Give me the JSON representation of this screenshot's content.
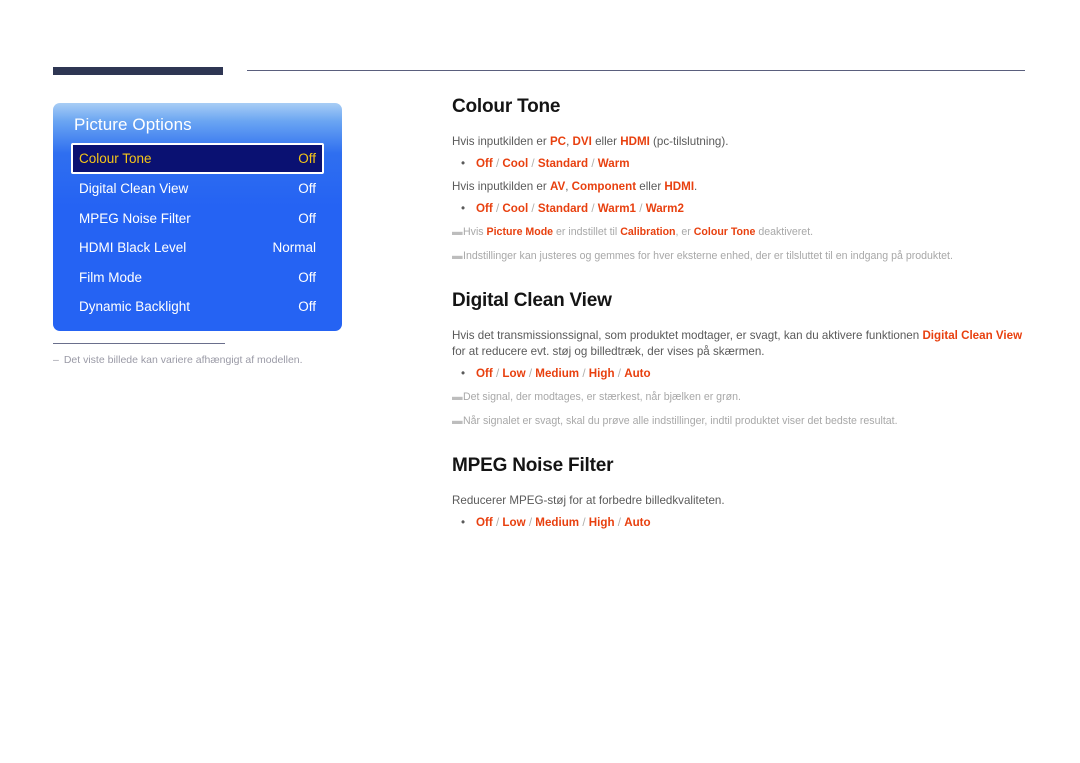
{
  "page": {
    "language": "da",
    "accent_color": "#e8400f",
    "header_bar_color": "#2e3653",
    "osd_blue": "#2563f3",
    "osd_selected_bg": "#0a1172",
    "osd_selected_text": "#f5c518"
  },
  "osd": {
    "title": "Picture Options",
    "rows": [
      {
        "label": "Colour Tone",
        "value": "Off",
        "selected": true
      },
      {
        "label": "Digital Clean View",
        "value": "Off",
        "selected": false
      },
      {
        "label": "MPEG Noise Filter",
        "value": "Off",
        "selected": false
      },
      {
        "label": "HDMI Black Level",
        "value": "Normal",
        "selected": false
      },
      {
        "label": "Film Mode",
        "value": "Off",
        "selected": false
      },
      {
        "label": "Dynamic Backlight",
        "value": "Off",
        "selected": false
      }
    ],
    "figure_note_dash": "–",
    "figure_note": "Det viste billede kan variere afhængigt af modellen."
  },
  "sections": {
    "colour_tone": {
      "heading": "Colour Tone",
      "para1_pre": "Hvis inputkilden er ",
      "para1_kw1": "PC",
      "para1_mid1": ", ",
      "para1_kw2": "DVI",
      "para1_mid2": " eller ",
      "para1_kw3": "HDMI",
      "para1_post": " (pc-tilslutning).",
      "options1": "Off / Cool / Standard / Warm",
      "options1_items": [
        "Off",
        "Cool",
        "Standard",
        "Warm"
      ],
      "para2_pre": "Hvis inputkilden er ",
      "para2_kw1": "AV",
      "para2_mid1": ", ",
      "para2_kw2": "Component",
      "para2_mid2": " eller ",
      "para2_kw3": "HDMI",
      "para2_post": ".",
      "options2": "Off / Cool / Standard / Warm1 / Warm2",
      "options2_items": [
        "Off",
        "Cool",
        "Standard",
        "Warm1",
        "Warm2"
      ],
      "note1_pre": "Hvis ",
      "note1_kw1": "Picture Mode",
      "note1_mid1": " er indstillet til ",
      "note1_kw2": "Calibration",
      "note1_mid2": ", er ",
      "note1_kw3": "Colour Tone",
      "note1_post": " deaktiveret.",
      "note2": "Indstillinger kan justeres og gemmes for hver eksterne enhed, der er tilsluttet til en indgang på produktet."
    },
    "digital_clean_view": {
      "heading": "Digital Clean View",
      "para_pre": "Hvis det transmissionssignal, som produktet modtager, er svagt, kan du aktivere funktionen ",
      "para_kw": "Digital Clean View",
      "para_post": " for at reducere evt. støj og billedtræk, der vises på skærmen.",
      "options": "Off / Low / Medium / High / Auto",
      "options_items": [
        "Off",
        "Low",
        "Medium",
        "High",
        "Auto"
      ],
      "note1": "Det signal, der modtages, er stærkest, når bjælken er grøn.",
      "note2": "Når signalet er svagt, skal du prøve alle indstillinger, indtil produktet viser det bedste resultat."
    },
    "mpeg_noise_filter": {
      "heading": "MPEG Noise Filter",
      "para": "Reducerer MPEG-støj for at forbedre billedkvaliteten.",
      "options": "Off / Low / Medium / High / Auto",
      "options_items": [
        "Off",
        "Low",
        "Medium",
        "High",
        "Auto"
      ]
    }
  },
  "glyphs": {
    "bullet": "•",
    "note_dash": "▬"
  }
}
